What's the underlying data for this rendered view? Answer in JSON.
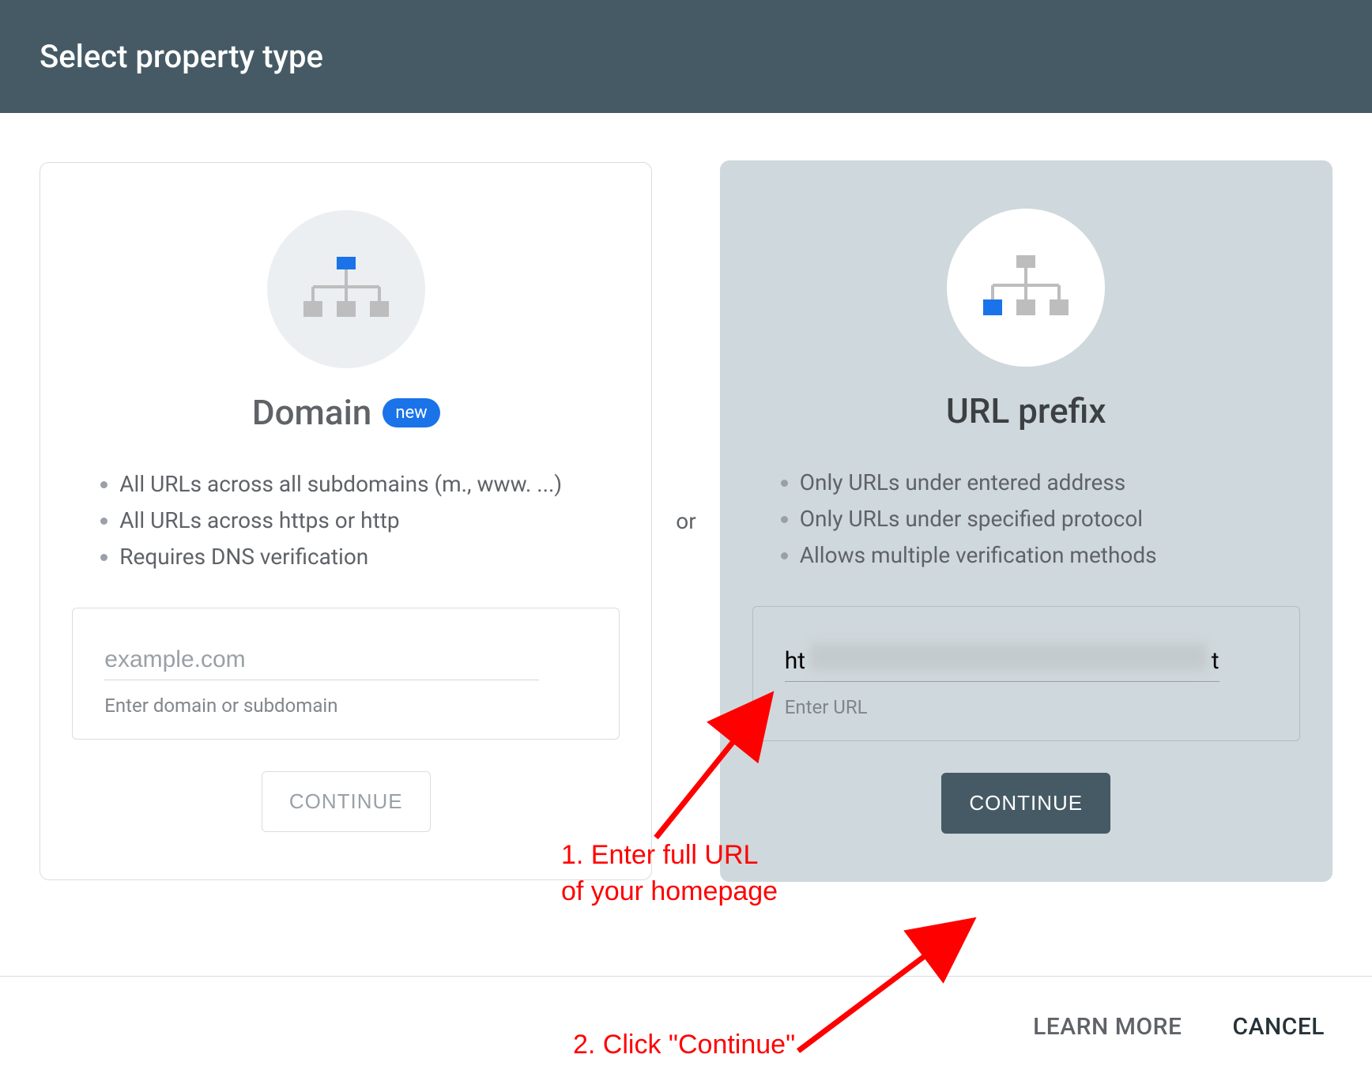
{
  "header": {
    "title": "Select property type"
  },
  "separator": "or",
  "domain_card": {
    "title": "Domain",
    "badge": "new",
    "bullets": [
      "All URLs across all subdomains (m., www. ...)",
      "All URLs across https or http",
      "Requires DNS verification"
    ],
    "input_placeholder": "example.com",
    "input_value": "",
    "helper": "Enter domain or subdomain",
    "button": "CONTINUE"
  },
  "url_card": {
    "title": "URL prefix",
    "bullets": [
      "Only URLs under entered address",
      "Only URLs under specified protocol",
      "Allows multiple verification methods"
    ],
    "input_value": "ht",
    "input_value_trailing": "t",
    "helper": "Enter URL",
    "button": "CONTINUE"
  },
  "footer": {
    "learn_more": "LEARN MORE",
    "cancel": "CANCEL"
  },
  "annotations": {
    "step1": "1. Enter full URL\nof your homepage",
    "step2": "2. Click \"Continue\""
  }
}
